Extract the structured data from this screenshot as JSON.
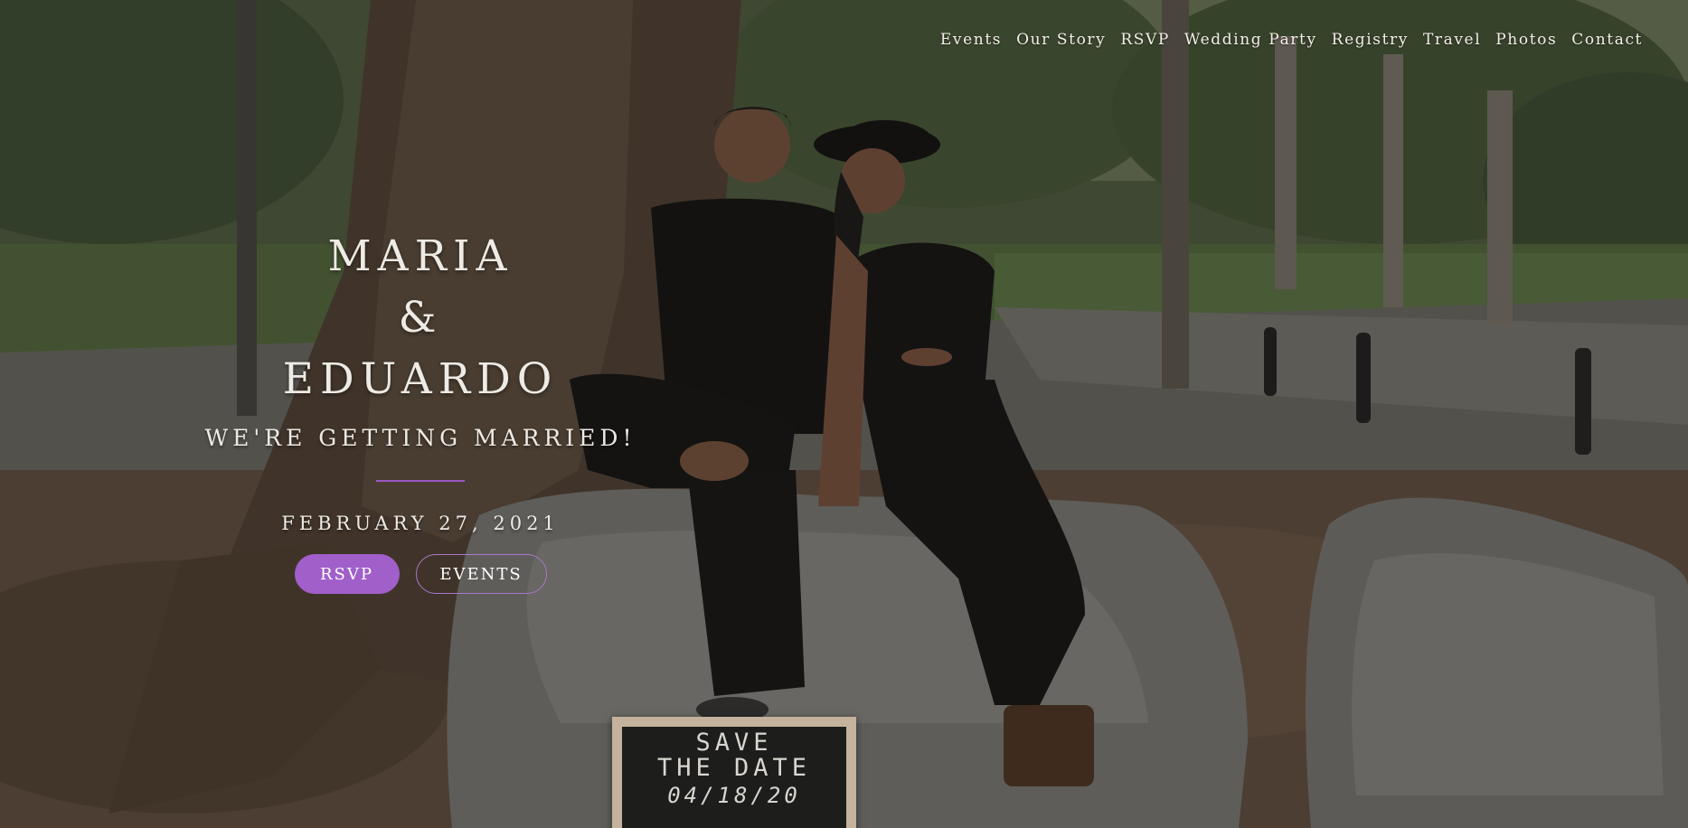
{
  "nav": {
    "items": [
      {
        "label": "Events"
      },
      {
        "label": "Our Story"
      },
      {
        "label": "RSVP"
      },
      {
        "label": "Wedding Party"
      },
      {
        "label": "Registry"
      },
      {
        "label": "Travel"
      },
      {
        "label": "Photos"
      },
      {
        "label": "Contact"
      }
    ]
  },
  "hero": {
    "name_1": "MARIA",
    "ampersand": "&",
    "name_2": "EDUARDO",
    "tagline": "WE'RE GETTING MARRIED!",
    "date": "FEBRUARY 27, 2021",
    "buttons": {
      "rsvp": "RSVP",
      "events": "EVENTS"
    }
  },
  "photo_sign": {
    "line_1": "SAVE",
    "line_2": "THE DATE",
    "date": "04/18/20"
  },
  "colors": {
    "accent": "#a05fc9",
    "text": "#eeeae4"
  }
}
